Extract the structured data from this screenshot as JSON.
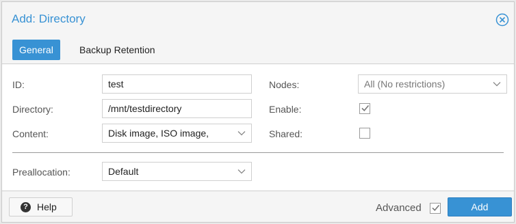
{
  "window": {
    "title": "Add: Directory"
  },
  "tabs": [
    {
      "label": "General",
      "active": true
    },
    {
      "label": "Backup Retention",
      "active": false
    }
  ],
  "form": {
    "id": {
      "label": "ID:",
      "value": "test"
    },
    "directory": {
      "label": "Directory:",
      "value": "/mnt/testdirectory"
    },
    "content": {
      "label": "Content:",
      "value": "Disk image, ISO image,"
    },
    "nodes": {
      "label": "Nodes:",
      "value": "All (No restrictions)"
    },
    "enable": {
      "label": "Enable:",
      "checked": true
    },
    "shared": {
      "label": "Shared:",
      "checked": false
    },
    "preallocation": {
      "label": "Preallocation:",
      "value": "Default"
    }
  },
  "footer": {
    "help_label": "Help",
    "advanced_label": "Advanced",
    "advanced_checked": true,
    "add_label": "Add"
  },
  "colors": {
    "accent": "#3892d4"
  }
}
